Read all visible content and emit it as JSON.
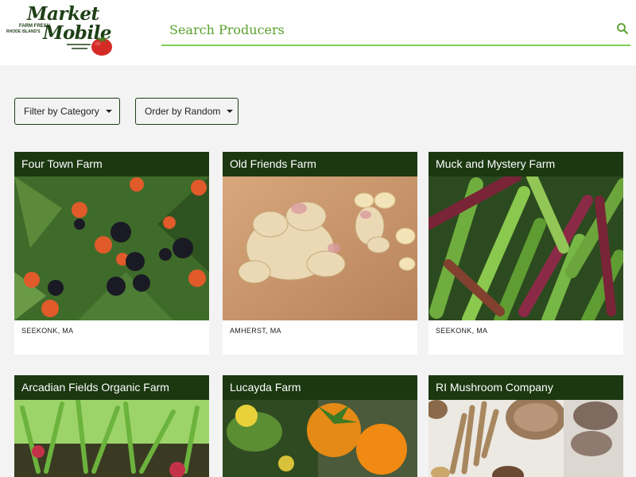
{
  "brand": {
    "name_line1": "Market",
    "name_line2": "Mobile",
    "tagline1": "FARM FRESH",
    "tagline2": "RHODE ISLAND'S"
  },
  "search": {
    "placeholder": "Search Producers",
    "icon": "search-icon"
  },
  "filters": {
    "category_label": "Filter by Category",
    "order_label": "Order by Random"
  },
  "producers": [
    {
      "name": "Four Town Farm",
      "location": "SEEKONK, MA"
    },
    {
      "name": "Old Friends Farm",
      "location": "AMHERST, MA"
    },
    {
      "name": "Muck and Mystery Farm",
      "location": "SEEKONK, MA"
    },
    {
      "name": "Arcadian Fields Organic Farm",
      "location": ""
    },
    {
      "name": "Lucayda Farm",
      "location": ""
    },
    {
      "name": "RI Mushroom Company",
      "location": ""
    }
  ],
  "colors": {
    "brand_dark": "#1b3811",
    "accent_green": "#7fcf52",
    "search_text": "#5aa02c",
    "background": "#f3f3f3"
  }
}
